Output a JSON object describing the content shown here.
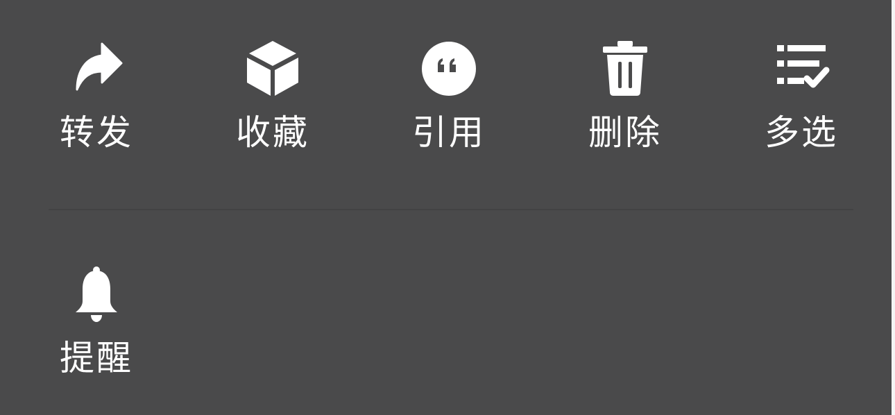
{
  "menu": {
    "items": [
      {
        "id": "forward",
        "label": "转发",
        "icon": "forward-arrow-icon"
      },
      {
        "id": "favorite",
        "label": "收藏",
        "icon": "cube-icon"
      },
      {
        "id": "quote",
        "label": "引用",
        "icon": "quote-icon"
      },
      {
        "id": "delete",
        "label": "删除",
        "icon": "trash-icon"
      },
      {
        "id": "multiselect",
        "label": "多选",
        "icon": "checklist-icon"
      },
      {
        "id": "remind",
        "label": "提醒",
        "icon": "bell-icon"
      }
    ]
  },
  "colors": {
    "panel_background": "#4a4a4b",
    "foreground": "#ffffff",
    "divider": "#424243"
  }
}
